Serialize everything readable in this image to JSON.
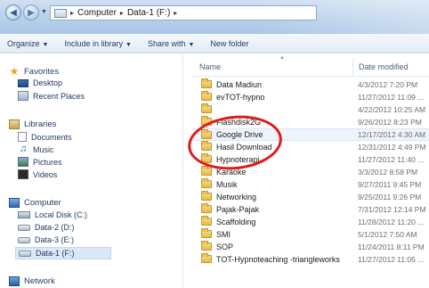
{
  "address": {
    "crumbs": [
      "Computer",
      "Data-1 (F:)"
    ]
  },
  "toolbar": {
    "organize": "Organize",
    "include": "Include in library",
    "share": "Share with",
    "newfolder": "New folder"
  },
  "nav": {
    "favorites": "Favorites",
    "desktop": "Desktop",
    "recent": "Recent Places",
    "libraries": "Libraries",
    "documents": "Documents",
    "music": "Music",
    "pictures": "Pictures",
    "videos": "Videos",
    "computer": "Computer",
    "localdisk": "Local Disk (C:)",
    "data2": "Data-2 (D:)",
    "data3": "Data-3 (E:)",
    "data1": "Data-1 (F:)",
    "network": "Network"
  },
  "columns": {
    "name": "Name",
    "date": "Date modified"
  },
  "files": [
    {
      "name": "Data Madiun",
      "date": "4/3/2012 7:20 PM"
    },
    {
      "name": "evTOT-hypno",
      "date": "11/27/2012 11:09 ..."
    },
    {
      "name": "",
      "date": "4/22/2012 10:25 AM"
    },
    {
      "name": "Flashdisk2G",
      "date": "9/26/2012 8:23 PM"
    },
    {
      "name": "Google Drive",
      "date": "12/17/2012 4:30 AM"
    },
    {
      "name": "Hasil Download",
      "date": "12/31/2012 4:49 PM"
    },
    {
      "name": "Hypnoterapi",
      "date": "11/27/2012 11:40 ..."
    },
    {
      "name": "Karaoke",
      "date": "3/3/2012 8:58 PM"
    },
    {
      "name": "Musik",
      "date": "9/27/2011 9:45 PM"
    },
    {
      "name": "Networking",
      "date": "9/25/2011 9:26 PM"
    },
    {
      "name": "Pajak-Pajak",
      "date": "7/31/2012 12:14 PM"
    },
    {
      "name": "Scaffolding",
      "date": "11/28/2012 11:20 ..."
    },
    {
      "name": "SMI",
      "date": "5/1/2012 7:50 AM"
    },
    {
      "name": "SOP",
      "date": "11/24/2011 8:11 PM"
    },
    {
      "name": "TOT-Hypnoteaching -triangleworks",
      "date": "11/27/2012 11:05 ..."
    }
  ],
  "colors": {
    "annotation": "#e0191b",
    "folder": "#e6b84a",
    "selection": "#dbe8f7"
  }
}
